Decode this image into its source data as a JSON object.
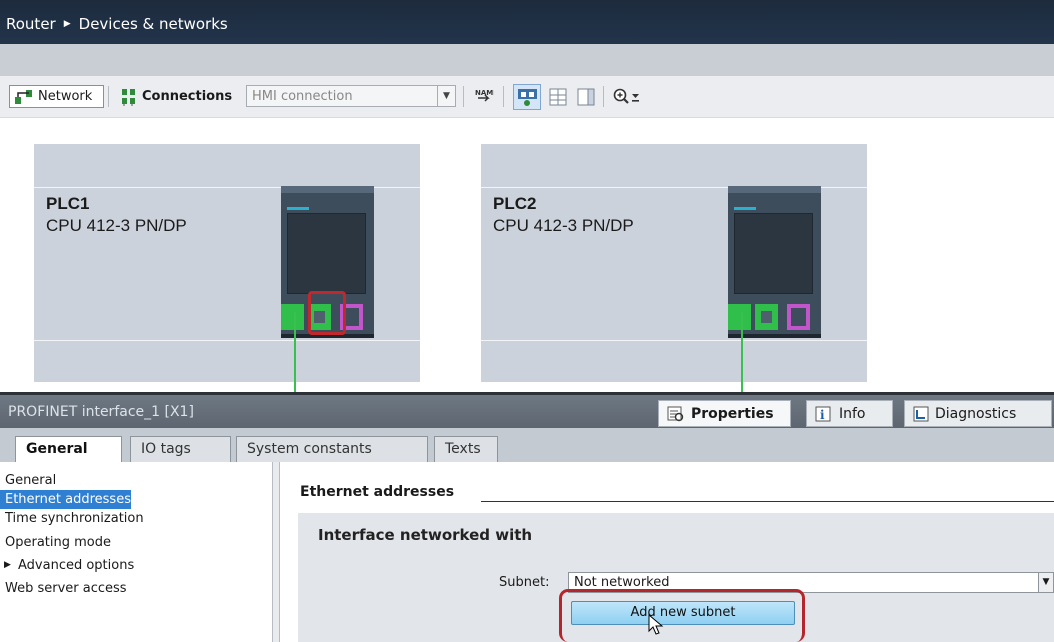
{
  "breadcrumb": {
    "root": "Router",
    "separator": "▶",
    "current": "Devices & networks"
  },
  "toolbar": {
    "network_label": "Network",
    "connections_label": "Connections",
    "connection_type_value": "HMI connection",
    "icons": [
      "show-network-view-icon",
      "name-icon",
      "show-interface-icon",
      "table-icon",
      "columns-icon",
      "zoom-icon"
    ]
  },
  "devices": [
    {
      "name": "PLC1",
      "type": "CPU 412-3 PN/DP"
    },
    {
      "name": "PLC2",
      "type": "CPU 412-3 PN/DP"
    }
  ],
  "properties_panel": {
    "title": "PROFINET interface_1 [X1]",
    "tabs": [
      {
        "label": "Properties",
        "active": true
      },
      {
        "label": "Info",
        "active": false
      },
      {
        "label": "Diagnostics",
        "active": false
      }
    ]
  },
  "inner_tabs": [
    {
      "label": "General",
      "active": true
    },
    {
      "label": "IO tags",
      "active": false
    },
    {
      "label": "System constants",
      "active": false
    },
    {
      "label": "Texts",
      "active": false
    }
  ],
  "nav_items": [
    {
      "label": "General",
      "selected": false,
      "expandable": false
    },
    {
      "label": "Ethernet addresses",
      "selected": true,
      "expandable": false
    },
    {
      "label": "Time synchronization",
      "selected": false,
      "expandable": false
    },
    {
      "label": "Operating mode",
      "selected": false,
      "expandable": false
    },
    {
      "label": "Advanced options",
      "selected": false,
      "expandable": true
    },
    {
      "label": "Web server access",
      "selected": false,
      "expandable": false
    }
  ],
  "content": {
    "section_heading": "Ethernet addresses",
    "subsection_heading": "Interface networked with",
    "subnet_label": "Subnet:",
    "subnet_value": "Not networked",
    "add_subnet_button": "Add new subnet"
  },
  "colors": {
    "title_bar": "#1d2b3d",
    "device_bg": "#ccd2db",
    "port_green": "#2fbf4a",
    "port_magenta": "#c056c9",
    "highlight_red": "#c0282e",
    "selection_blue": "#2f7fd3"
  }
}
